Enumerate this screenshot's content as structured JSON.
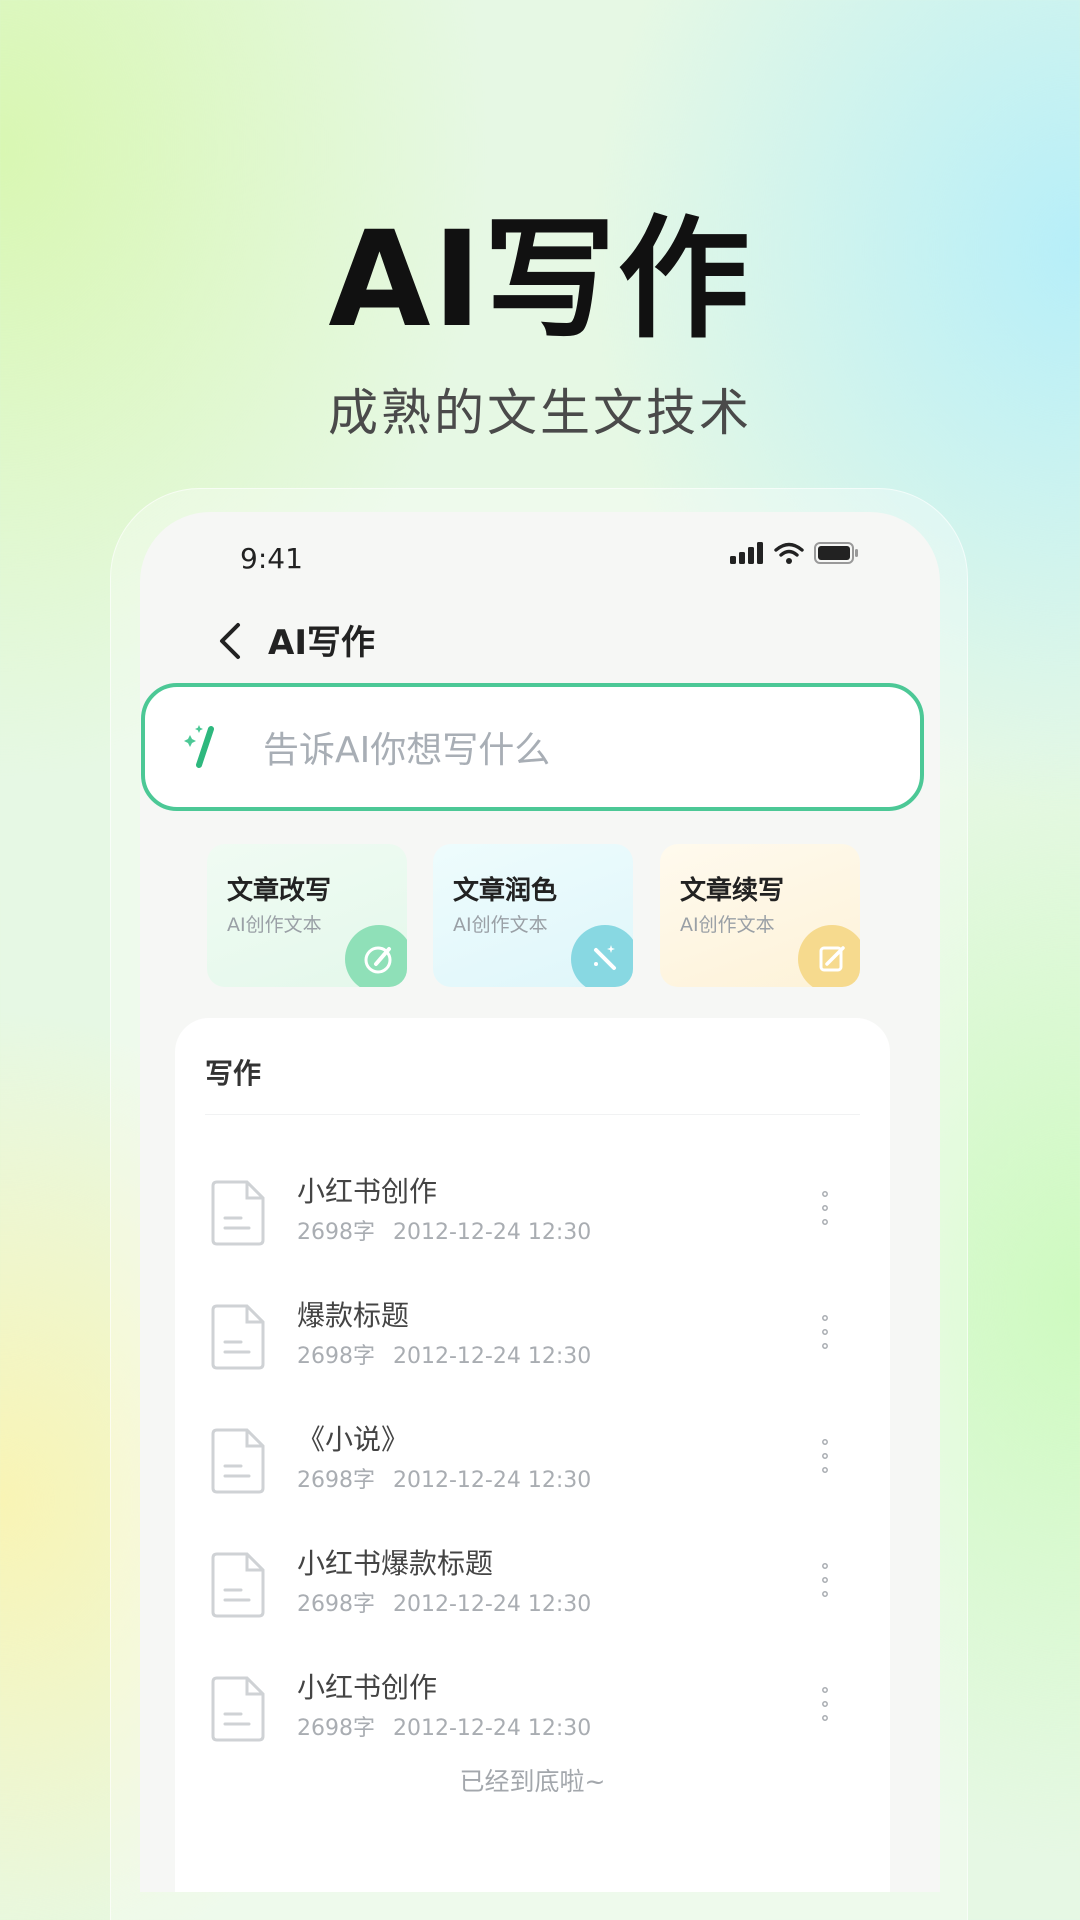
{
  "hero": {
    "title": "AI写作",
    "subtitle": "成熟的文生文技术"
  },
  "status_bar": {
    "time": "9:41",
    "icons": [
      "signal-icon",
      "wifi-icon",
      "battery-icon"
    ]
  },
  "nav": {
    "back_icon": "chevron-left-icon",
    "title": "AI写作"
  },
  "search": {
    "icon": "magic-wand-icon",
    "placeholder": "告诉AI你想写什么",
    "border_color": "#4cc896"
  },
  "features": [
    {
      "title": "文章改写",
      "subtitle": "AI创作文本",
      "icon": "pen-edit-icon",
      "color": "#8fe0b8"
    },
    {
      "title": "文章润色",
      "subtitle": "AI创作文本",
      "icon": "magic-wand-icon",
      "color": "#88d8e2"
    },
    {
      "title": "文章续写",
      "subtitle": "AI创作文本",
      "icon": "note-edit-icon",
      "color": "#f6da8e"
    }
  ],
  "list": {
    "heading": "写作",
    "items": [
      {
        "title": "小红书创作",
        "words": "2698字",
        "date": "2012-12-24 12:30"
      },
      {
        "title": "爆款标题",
        "words": "2698字",
        "date": "2012-12-24 12:30"
      },
      {
        "title": "《小说》",
        "words": "2698字",
        "date": "2012-12-24 12:30"
      },
      {
        "title": "小红书爆款标题",
        "words": "2698字",
        "date": "2012-12-24 12:30"
      },
      {
        "title": "小红书创作",
        "words": "2698字",
        "date": "2012-12-24 12:30"
      }
    ],
    "footer": "已经到底啦~"
  }
}
